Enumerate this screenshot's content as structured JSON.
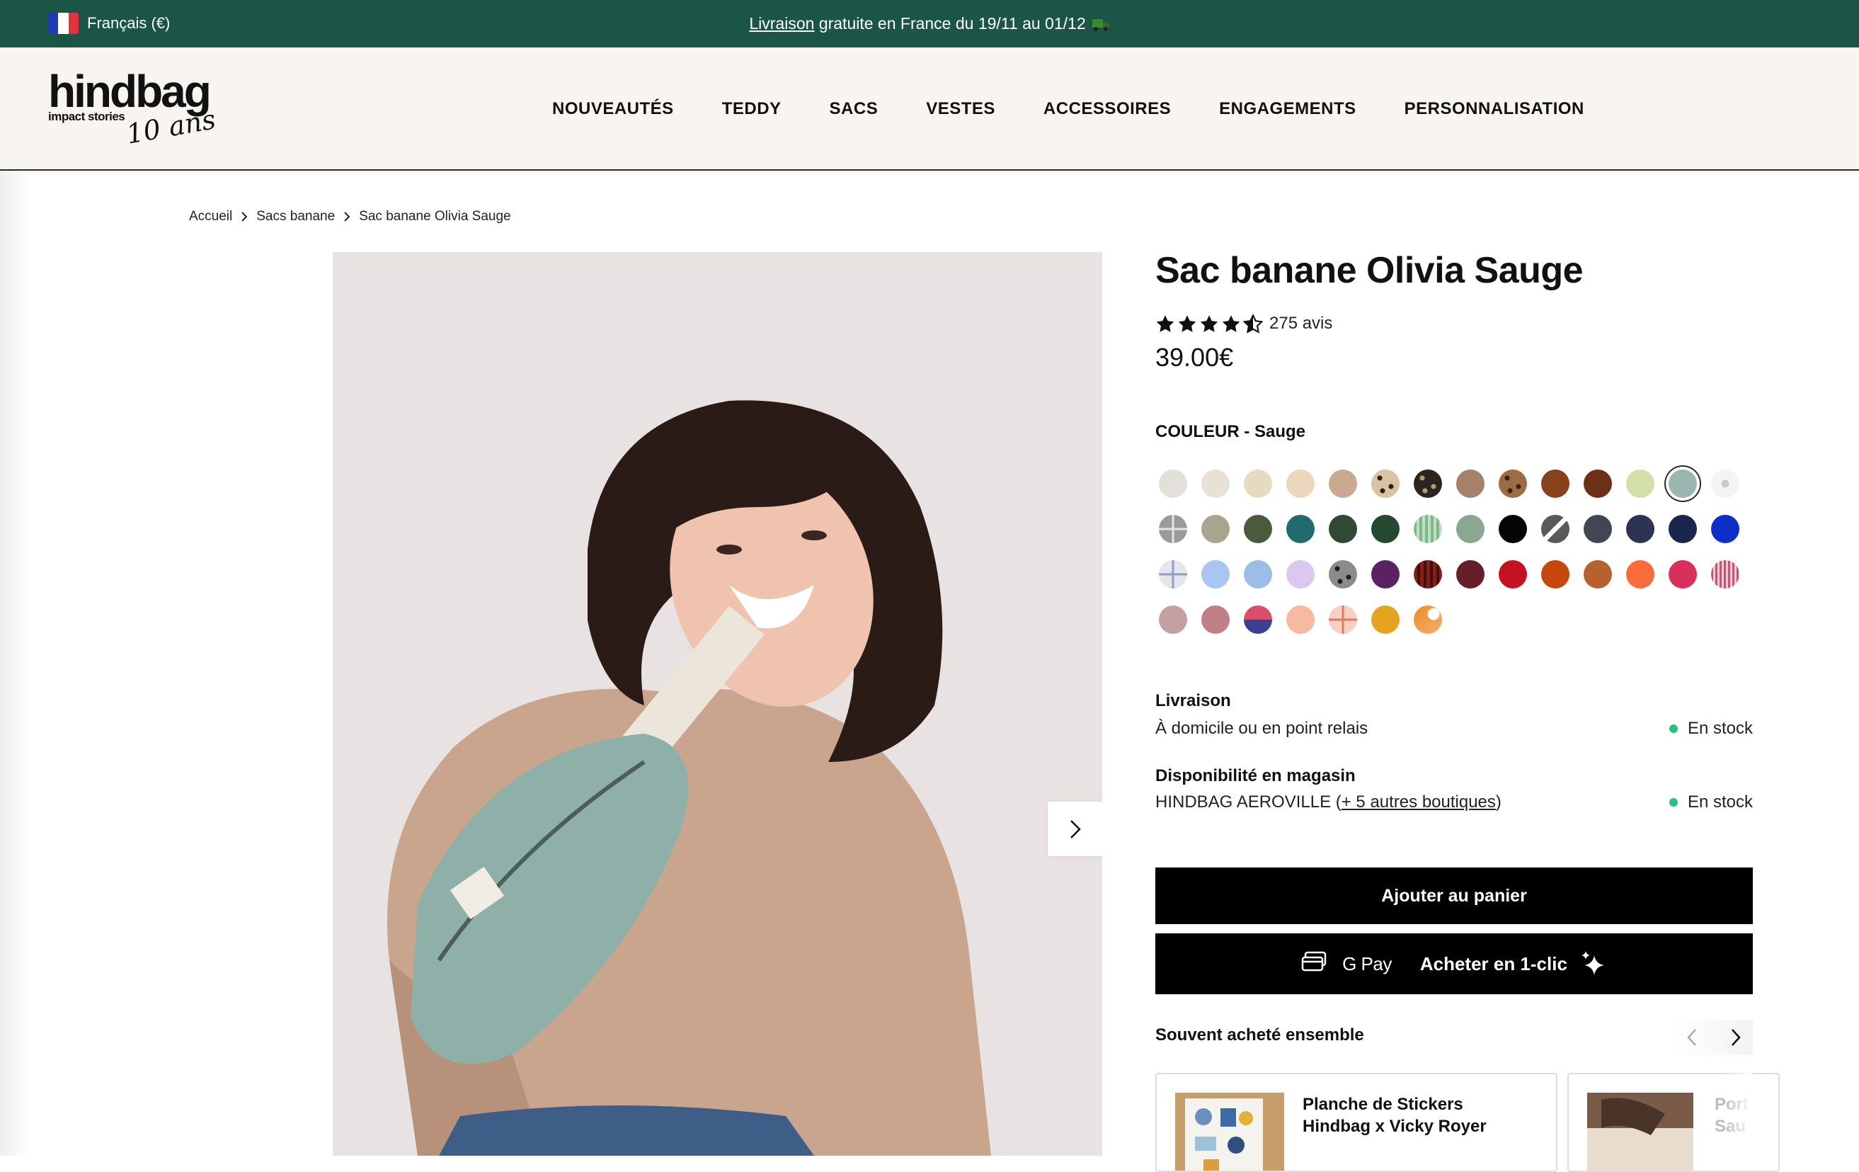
{
  "topbar": {
    "language": "Français (€)",
    "announcement_link": "Livraison",
    "announcement_text": " gratuite en France du 19/11 au 01/12"
  },
  "header": {
    "logo_main": "hindbag",
    "logo_sub": "impact stories",
    "logo_badge": "10 ans",
    "nav": [
      "NOUVEAUTÉS",
      "TEDDY",
      "SACS",
      "VESTES",
      "ACCESSOIRES",
      "ENGAGEMENTS",
      "PERSONNALISATION"
    ]
  },
  "breadcrumb": [
    "Accueil",
    "Sacs banane",
    "Sac banane Olivia Sauge"
  ],
  "product": {
    "title": "Sac banane Olivia Sauge",
    "rating": 4.5,
    "reviews": "275 avis",
    "price": "39.00€",
    "color_label": "COULEUR - Sauge",
    "selected_color": "Sauge",
    "swatches": [
      [
        "#e3dfd9",
        "#e7e1d6",
        "#e6dac1",
        "#ecd7bd",
        "#c9a98f",
        "leopard",
        "leopard-dark",
        "#a58168",
        "leopard-brown",
        "#87411b",
        "#6c2f17",
        "#d2dfa8",
        "#9bb5b1",
        "heart"
      ],
      [
        "cross-grey",
        "#a7a58e",
        "#4b5a3c",
        "#216b6e",
        "#2e4934",
        "#254a31",
        "check-green",
        "#8aa792",
        "#050505",
        "stripe-grey",
        "#414652",
        "#2c3452",
        "#1b254e",
        "#0d2fc9"
      ],
      [
        "cross-light",
        "#a9c5f1",
        "#9dbde9",
        "#dcc8ef",
        "leopard-grey",
        "#5c2163",
        "plaid-red",
        "#661e2b",
        "#c51222",
        "#c8470f",
        "#b6612f",
        "#fb6b3d",
        "#d7305c",
        "check-pink"
      ],
      [
        "#c5a0a2",
        "#c17e87",
        "bicolor",
        "#f7b9a0",
        "cross-peach",
        "#e4a422",
        "dots-orange"
      ]
    ]
  },
  "delivery": {
    "heading": "Livraison",
    "text": "À domicile ou en point relais",
    "status": "En stock"
  },
  "store": {
    "heading": "Disponibilité en magasin",
    "store_name": "HINDBAG AEROVILLE (",
    "more_link": "+ 5 autres boutiques",
    "close_paren": ")",
    "status": "En stock"
  },
  "buttons": {
    "add_to_cart": "Ajouter au panier",
    "gpay": "G Pay",
    "one_click": "Acheter en 1-clic"
  },
  "frequently": {
    "heading": "Souvent acheté ensemble",
    "items": [
      {
        "title_line1": "Planche de Stickers",
        "title_line2": "Hindbag x Vicky Royer"
      },
      {
        "title_line1": "Port",
        "title_line2": "Sau"
      }
    ]
  },
  "colors": {
    "topbar": "#1b5545",
    "header_bg": "#f8f5f1",
    "in_stock": "#28c17a",
    "button": "#000000"
  }
}
